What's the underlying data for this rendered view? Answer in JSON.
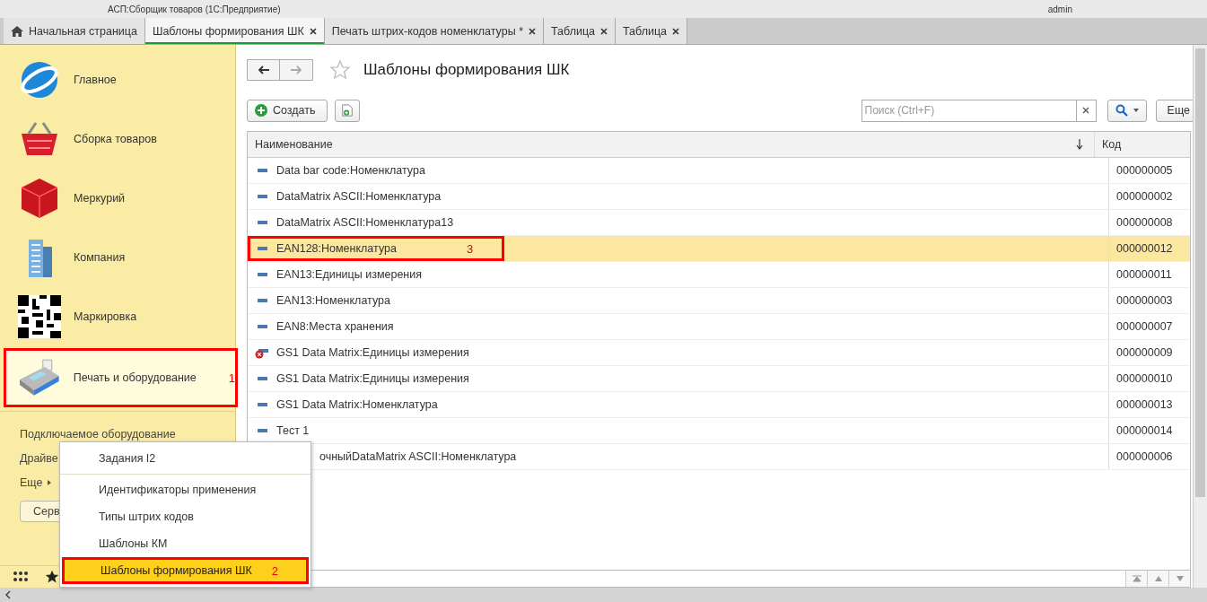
{
  "window": {
    "title": "АСП:Сборщик товаров (1С:Предприятие)",
    "user": "admin"
  },
  "tabs": [
    {
      "label": "Начальная страница",
      "selected": false,
      "closable": false
    },
    {
      "label": "Шаблоны формирования ШК",
      "selected": true,
      "closable": true
    },
    {
      "label": "Печать штрих-кодов номенклатуры *",
      "selected": false,
      "closable": true
    },
    {
      "label": "Таблица",
      "selected": false,
      "closable": true
    },
    {
      "label": "Таблица",
      "selected": false,
      "closable": true
    }
  ],
  "sidebar": {
    "sections": [
      {
        "label": "Главное",
        "selected": false
      },
      {
        "label": "Сборка товаров",
        "selected": false
      },
      {
        "label": "Меркурий",
        "selected": false
      },
      {
        "label": "Компания",
        "selected": false
      },
      {
        "label": "Маркировка",
        "selected": false
      },
      {
        "label": "Печать и оборудование",
        "selected": true,
        "annotation": "1"
      }
    ],
    "links": [
      {
        "label": "Подключаемое оборудование",
        "kind": "link"
      },
      {
        "label": "Драйве",
        "kind": "link"
      },
      {
        "label": "Еще",
        "kind": "more"
      },
      {
        "label": "Серв",
        "kind": "button"
      }
    ]
  },
  "popup_menu": {
    "items": [
      {
        "label": "Задания I2",
        "selected": false,
        "separator_after": true
      },
      {
        "label": "Идентификаторы применения",
        "selected": false,
        "separator_after": false
      },
      {
        "label": "Типы штрих кодов",
        "selected": false,
        "separator_after": false
      },
      {
        "label": "Шаблоны КМ",
        "selected": false,
        "separator_after": false
      },
      {
        "label": "Шаблоны формирования ШК",
        "selected": true,
        "separator_after": false,
        "annotation": "2"
      }
    ]
  },
  "page": {
    "title": "Шаблоны формирования ШК",
    "create_button": "Создать",
    "search": {
      "placeholder": "Поиск (Ctrl+F)"
    },
    "more_button": "Еще"
  },
  "table": {
    "columns": [
      "Наименование",
      "Код"
    ],
    "rows": [
      {
        "name": "Data bar code:Номенклатура",
        "code": "000000005",
        "selected": false,
        "deleted": false,
        "covered": false
      },
      {
        "name": "DataMatrix ASCII:Номенклатура",
        "code": "000000002",
        "selected": false,
        "deleted": false,
        "covered": false
      },
      {
        "name": "DataMatrix ASCII:Номенклатура13",
        "code": "000000008",
        "selected": false,
        "deleted": false,
        "covered": false
      },
      {
        "name": "EAN128:Номенклатура",
        "code": "000000012",
        "selected": true,
        "deleted": false,
        "covered": false,
        "annotation": "3"
      },
      {
        "name": "EAN13:Единицы измерения",
        "code": "000000011",
        "selected": false,
        "deleted": false,
        "covered": false
      },
      {
        "name": "EAN13:Номенклатура",
        "code": "000000003",
        "selected": false,
        "deleted": false,
        "covered": false
      },
      {
        "name": "EAN8:Места хранения",
        "code": "000000007",
        "selected": false,
        "deleted": false,
        "covered": false
      },
      {
        "name": "GS1 Data Matrix:Единицы измерения",
        "code": "000000009",
        "selected": false,
        "deleted": true,
        "covered": false
      },
      {
        "name": "GS1 Data Matrix:Единицы измерения",
        "code": "000000010",
        "selected": false,
        "deleted": false,
        "covered": false
      },
      {
        "name": "GS1 Data Matrix:Номенклатура",
        "code": "000000013",
        "selected": false,
        "deleted": false,
        "covered": false
      },
      {
        "name": "Тест 1",
        "code": "000000014",
        "selected": false,
        "deleted": false,
        "covered": false
      },
      {
        "name": "очныйDataMatrix ASCII:Номенклатура",
        "code": "000000006",
        "selected": false,
        "covered": true
      }
    ]
  }
}
